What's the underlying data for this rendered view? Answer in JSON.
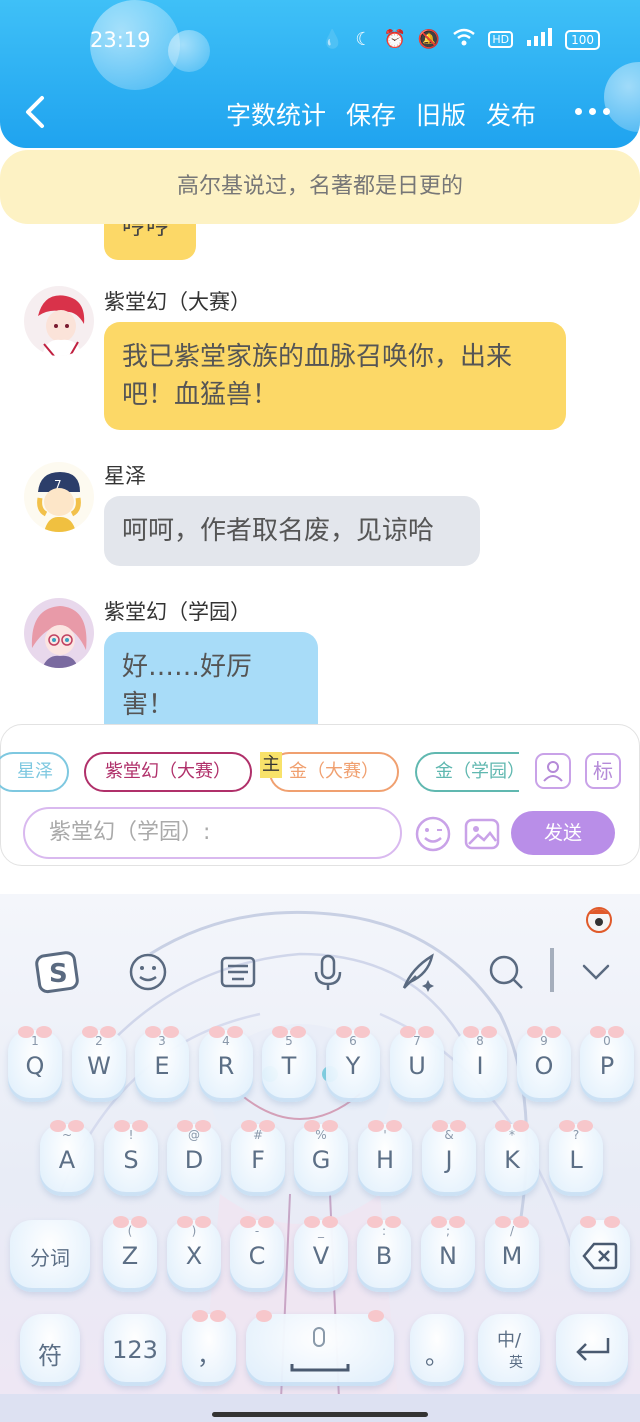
{
  "status_bar": {
    "time": "23:19",
    "battery": "100"
  },
  "header": {
    "actions": [
      "字数统计",
      "保存",
      "旧版",
      "发布"
    ]
  },
  "banner": {
    "text": "高尔基说过，名著都是日更的"
  },
  "chat": {
    "partial_message": "哼哼",
    "messages": [
      {
        "sender": "紫堂幻（大赛）",
        "text": "我已紫堂家族的血脉召唤你，出来吧！血猛兽！",
        "color": "#fcd867"
      },
      {
        "sender": "星泽",
        "text": "呵呵，作者取名废，见谅哈",
        "color": "#e3e6ec"
      },
      {
        "sender": "紫堂幻（学园）",
        "text": "好……好厉害！",
        "color": "#a8dcf8"
      }
    ]
  },
  "composer": {
    "chips": [
      {
        "label": "星泽",
        "color": "#7ec8e0"
      },
      {
        "label": "紫堂幻（大赛）",
        "color": "#b0306a"
      },
      {
        "label": "金（大赛）",
        "color": "#f0a070"
      },
      {
        "label": "金（学园）",
        "color": "#60b8b0"
      }
    ],
    "main_tag": "主",
    "tag_button": "标",
    "input_placeholder": "紫堂幻（学园）:",
    "send_label": "发送"
  },
  "keyboard": {
    "row1": [
      {
        "main": "Q",
        "sub": "1"
      },
      {
        "main": "W",
        "sub": "2"
      },
      {
        "main": "E",
        "sub": "3"
      },
      {
        "main": "R",
        "sub": "4"
      },
      {
        "main": "T",
        "sub": "5"
      },
      {
        "main": "Y",
        "sub": "6"
      },
      {
        "main": "U",
        "sub": "7"
      },
      {
        "main": "I",
        "sub": "8"
      },
      {
        "main": "O",
        "sub": "9"
      },
      {
        "main": "P",
        "sub": "0"
      }
    ],
    "row2": [
      {
        "main": "A",
        "sub": "~"
      },
      {
        "main": "S",
        "sub": "!"
      },
      {
        "main": "D",
        "sub": "@"
      },
      {
        "main": "F",
        "sub": "#"
      },
      {
        "main": "G",
        "sub": "%"
      },
      {
        "main": "H",
        "sub": "'"
      },
      {
        "main": "J",
        "sub": "&"
      },
      {
        "main": "K",
        "sub": "*"
      },
      {
        "main": "L",
        "sub": "?"
      }
    ],
    "row3": [
      {
        "main": "Z",
        "sub": "("
      },
      {
        "main": "X",
        "sub": ")"
      },
      {
        "main": "C",
        "sub": "-"
      },
      {
        "main": "V",
        "sub": "_"
      },
      {
        "main": "B",
        "sub": ":"
      },
      {
        "main": "N",
        "sub": ";"
      },
      {
        "main": "M",
        "sub": "/"
      }
    ],
    "segment_key": "分词",
    "symbol_key": "符",
    "number_key": "123",
    "comma_key": "，",
    "period_key": "。",
    "lang_key_top": "中/",
    "lang_key_bottom": "英"
  }
}
